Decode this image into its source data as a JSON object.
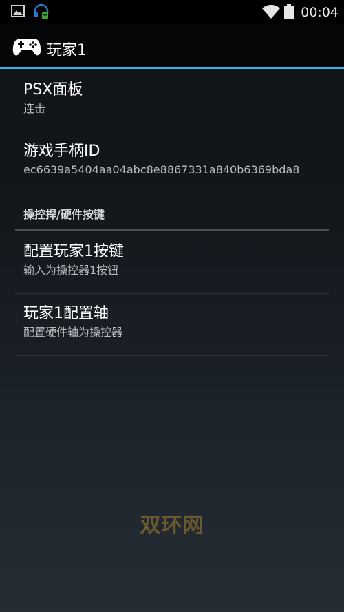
{
  "status_bar": {
    "time": "00:04",
    "icons": [
      "image-notification-icon",
      "headset-notification-icon",
      "wifi-icon",
      "battery-icon"
    ]
  },
  "action_bar": {
    "title": "玩家1",
    "icon": "gamepad-icon",
    "accent_color": "#33b5e5"
  },
  "preferences": {
    "psx_panel": {
      "title": "PSX面板",
      "summary": "连击"
    },
    "gamepad_id": {
      "title": "游戏手柄ID",
      "summary": "ec6639a5404aa04abc8e8867331a840b6369bda8"
    },
    "category": {
      "title": "操控捍/硬件按键"
    },
    "configure_buttons": {
      "title": "配置玩家1按键",
      "summary": "输入为操控器1按钮"
    },
    "configure_axes": {
      "title": "玩家1配置轴",
      "summary": "配置硬件轴为操控器"
    }
  },
  "watermark": {
    "text": "双环网"
  }
}
